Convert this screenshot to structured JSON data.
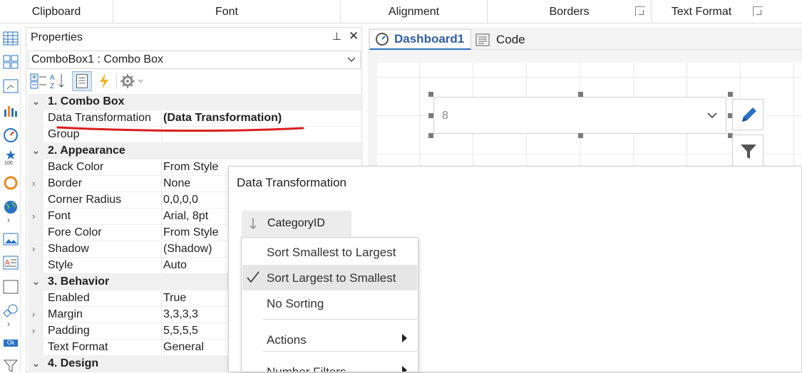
{
  "ribbon": {
    "groups": [
      "Clipboard",
      "Font",
      "Alignment",
      "Borders",
      "Text Format"
    ]
  },
  "properties": {
    "title": "Properties",
    "pin_glyph": "⊥",
    "close_glyph": "✕",
    "selected_object": "ComboBox1 : Combo Box",
    "rows": [
      {
        "kind": "cat",
        "exp": "⌄",
        "name": "1. Combo  Box"
      },
      {
        "kind": "prop",
        "exp": "",
        "name": "Data Transformation",
        "value": "(Data Transformation)"
      },
      {
        "kind": "prop",
        "exp": "",
        "name": "Group",
        "value": ""
      },
      {
        "kind": "cat",
        "exp": "⌄",
        "name": "2. Appearance"
      },
      {
        "kind": "prop",
        "exp": "",
        "name": "Back Color",
        "value": "From Style"
      },
      {
        "kind": "prop",
        "exp": "›",
        "name": "Border",
        "value": "None"
      },
      {
        "kind": "prop",
        "exp": "",
        "name": "Corner Radius",
        "value": "0,0,0,0"
      },
      {
        "kind": "prop",
        "exp": "›",
        "name": "Font",
        "value": "Arial, 8pt"
      },
      {
        "kind": "prop",
        "exp": "",
        "name": "Fore Color",
        "value": "From Style"
      },
      {
        "kind": "prop",
        "exp": "›",
        "name": "Shadow",
        "value": "(Shadow)"
      },
      {
        "kind": "prop",
        "exp": "",
        "name": "Style",
        "value": "Auto"
      },
      {
        "kind": "cat",
        "exp": "⌄",
        "name": "3. Behavior"
      },
      {
        "kind": "prop",
        "exp": "",
        "name": "Enabled",
        "value": "True"
      },
      {
        "kind": "prop",
        "exp": "›",
        "name": "Margin",
        "value": "3,3,3,3"
      },
      {
        "kind": "prop",
        "exp": "›",
        "name": "Padding",
        "value": "5,5,5,5"
      },
      {
        "kind": "prop",
        "exp": "",
        "name": "Text Format",
        "value": "General"
      },
      {
        "kind": "cat",
        "exp": "⌄",
        "name": "4. Design"
      }
    ]
  },
  "designer": {
    "tabs": [
      {
        "label": "Dashboard1",
        "icon": "dashboard-tab-icon"
      },
      {
        "label": "Code",
        "icon": "code-tab-icon"
      }
    ],
    "combo_value": "8"
  },
  "popup": {
    "title": "Data Transformation",
    "field_label": "CategoryID",
    "menu": [
      {
        "label": "Sort Smallest to Largest",
        "checked": false
      },
      {
        "label": "Sort Largest to Smallest",
        "checked": true
      },
      {
        "label": "No Sorting",
        "checked": false
      },
      {
        "label": "Actions",
        "submenu": true
      },
      {
        "label": "Number Filters",
        "submenu": true
      }
    ]
  },
  "colors": {
    "accent": "#2e6fbf",
    "annotation_underline": "#d91e1e",
    "toolbox_blue": "#2a72c4",
    "toolbox_orange": "#ef8a1c"
  }
}
